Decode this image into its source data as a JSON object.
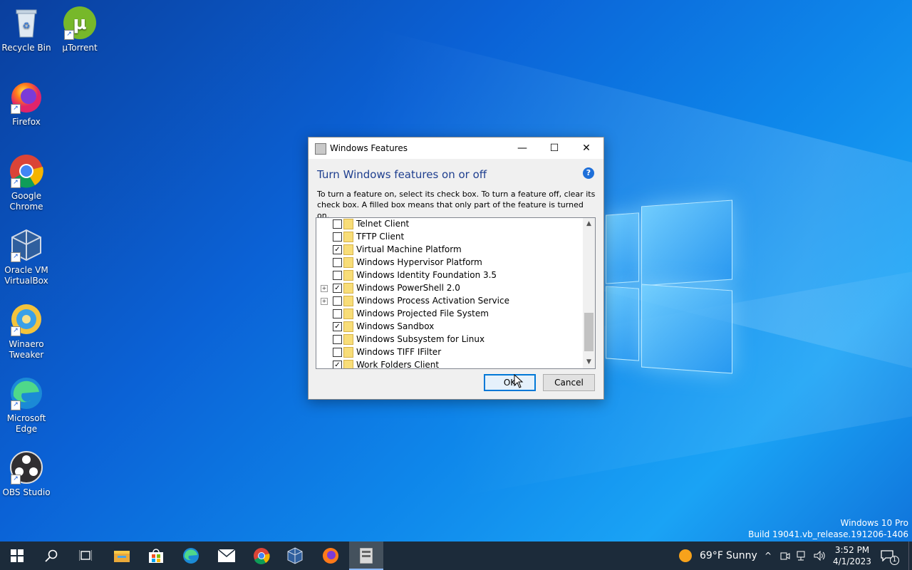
{
  "desktop": {
    "icons": [
      {
        "label": "Recycle Bin",
        "icon": "recycle-bin-icon"
      },
      {
        "label": "µTorrent",
        "icon": "utorrent-icon"
      },
      {
        "label": "Firefox",
        "icon": "firefox-icon"
      },
      {
        "label": "Google Chrome",
        "icon": "chrome-icon"
      },
      {
        "label": "Oracle VM VirtualBox",
        "icon": "virtualbox-icon"
      },
      {
        "label": "Winaero Tweaker",
        "icon": "winaero-tweaker-icon"
      },
      {
        "label": "Microsoft Edge",
        "icon": "edge-icon"
      },
      {
        "label": "OBS Studio",
        "icon": "obs-icon"
      }
    ],
    "watermark": {
      "line1": "Windows 10 Pro",
      "line2": "Build 19041.vb_release.191206-1406"
    }
  },
  "dialog": {
    "title": "Windows Features",
    "heading": "Turn Windows features on or off",
    "help": "?",
    "description": "To turn a feature on, select its check box. To turn a feature off, clear its check box. A filled box means that only part of the feature is turned on.",
    "features": [
      {
        "label": "Telnet Client",
        "checked": false,
        "expandable": false
      },
      {
        "label": "TFTP Client",
        "checked": false,
        "expandable": false
      },
      {
        "label": "Virtual Machine Platform",
        "checked": true,
        "expandable": false
      },
      {
        "label": "Windows Hypervisor Platform",
        "checked": false,
        "expandable": false
      },
      {
        "label": "Windows Identity Foundation 3.5",
        "checked": false,
        "expandable": false
      },
      {
        "label": "Windows PowerShell 2.0",
        "checked": true,
        "expandable": true
      },
      {
        "label": "Windows Process Activation Service",
        "checked": false,
        "expandable": true
      },
      {
        "label": "Windows Projected File System",
        "checked": false,
        "expandable": false
      },
      {
        "label": "Windows Sandbox",
        "checked": true,
        "expandable": false
      },
      {
        "label": "Windows Subsystem for Linux",
        "checked": false,
        "expandable": false
      },
      {
        "label": "Windows TIFF IFilter",
        "checked": false,
        "expandable": false
      },
      {
        "label": "Work Folders Client",
        "checked": true,
        "expandable": false
      }
    ],
    "ok_label": "OK",
    "cancel_label": "Cancel"
  },
  "taskbar": {
    "weather": {
      "temp": "69°F",
      "condition": "Sunny"
    },
    "clock": {
      "time": "3:52 PM",
      "date": "4/1/2023"
    },
    "notification_count": "1",
    "apps": [
      "start-icon",
      "search-icon",
      "task-view-icon",
      "file-explorer-icon",
      "store-icon",
      "edge-icon",
      "mail-icon",
      "chrome-icon",
      "virtualbox-icon",
      "firefox-icon",
      "windows-features-icon"
    ]
  },
  "colors": {
    "accent": "#0078d7",
    "heading": "#1f3f8f",
    "taskbar": "#1c2b3a"
  }
}
